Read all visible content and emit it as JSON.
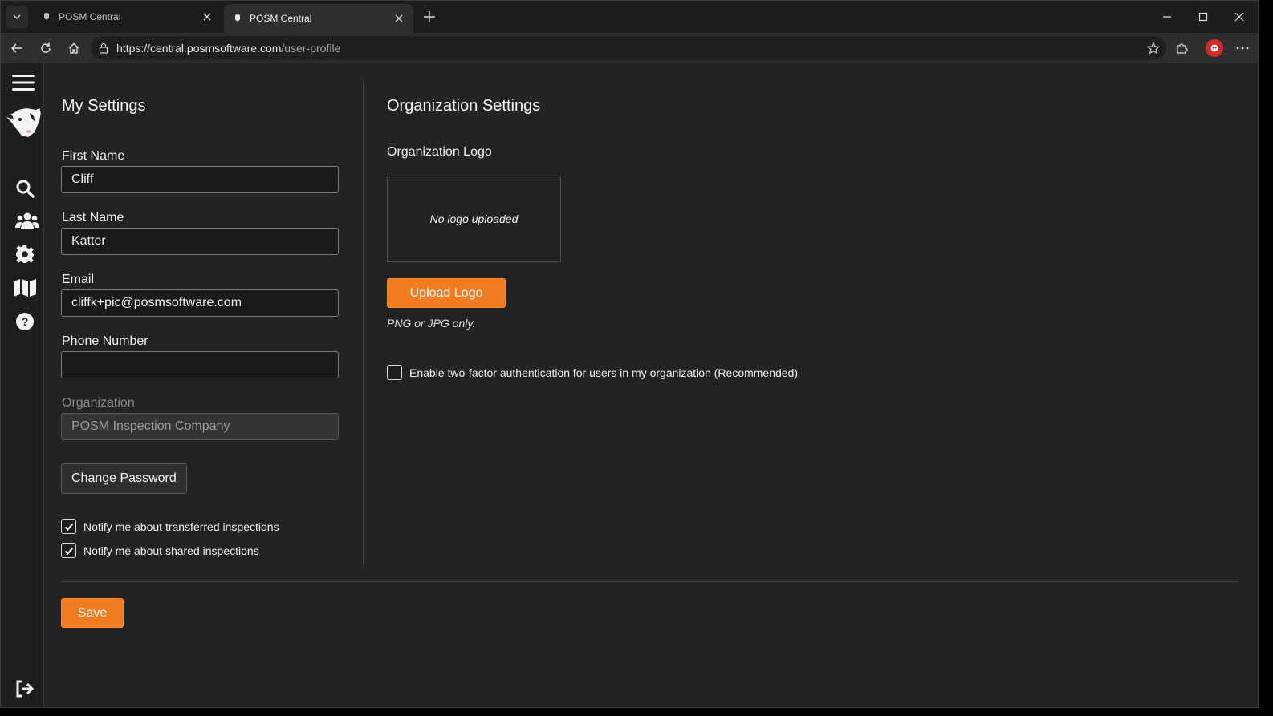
{
  "browser": {
    "tabs": [
      {
        "title": "POSM Central",
        "active": false
      },
      {
        "title": "POSM Central",
        "active": true
      }
    ],
    "url_host": "https://central.posmsoftware.com",
    "url_path": "/user-profile"
  },
  "sidebar": {
    "items": [
      "menu-icon",
      "search-icon",
      "users-icon",
      "gear-icon",
      "map-icon",
      "help-icon",
      "logout-icon"
    ]
  },
  "my_settings": {
    "heading": "My Settings",
    "first_name_label": "First Name",
    "first_name_value": "Cliff",
    "last_name_label": "Last Name",
    "last_name_value": "Katter",
    "email_label": "Email",
    "email_value": "cliffk+pic@posmsoftware.com",
    "phone_label": "Phone Number",
    "phone_value": "",
    "org_label": "Organization",
    "org_value": "POSM Inspection Company",
    "change_password": "Change Password",
    "notify_transferred": "Notify me about transferred inspections",
    "notify_transferred_checked": true,
    "notify_shared": "Notify me about shared inspections",
    "notify_shared_checked": true
  },
  "org_settings": {
    "heading": "Organization Settings",
    "logo_label": "Organization Logo",
    "no_logo": "No logo uploaded",
    "upload_button": "Upload Logo",
    "upload_hint": "PNG or JPG only.",
    "two_factor": "Enable two-factor authentication for users in my organization (Recommended)",
    "two_factor_checked": false
  },
  "save_button": "Save",
  "colors": {
    "accent": "#f07c1f",
    "background": "#232323"
  }
}
